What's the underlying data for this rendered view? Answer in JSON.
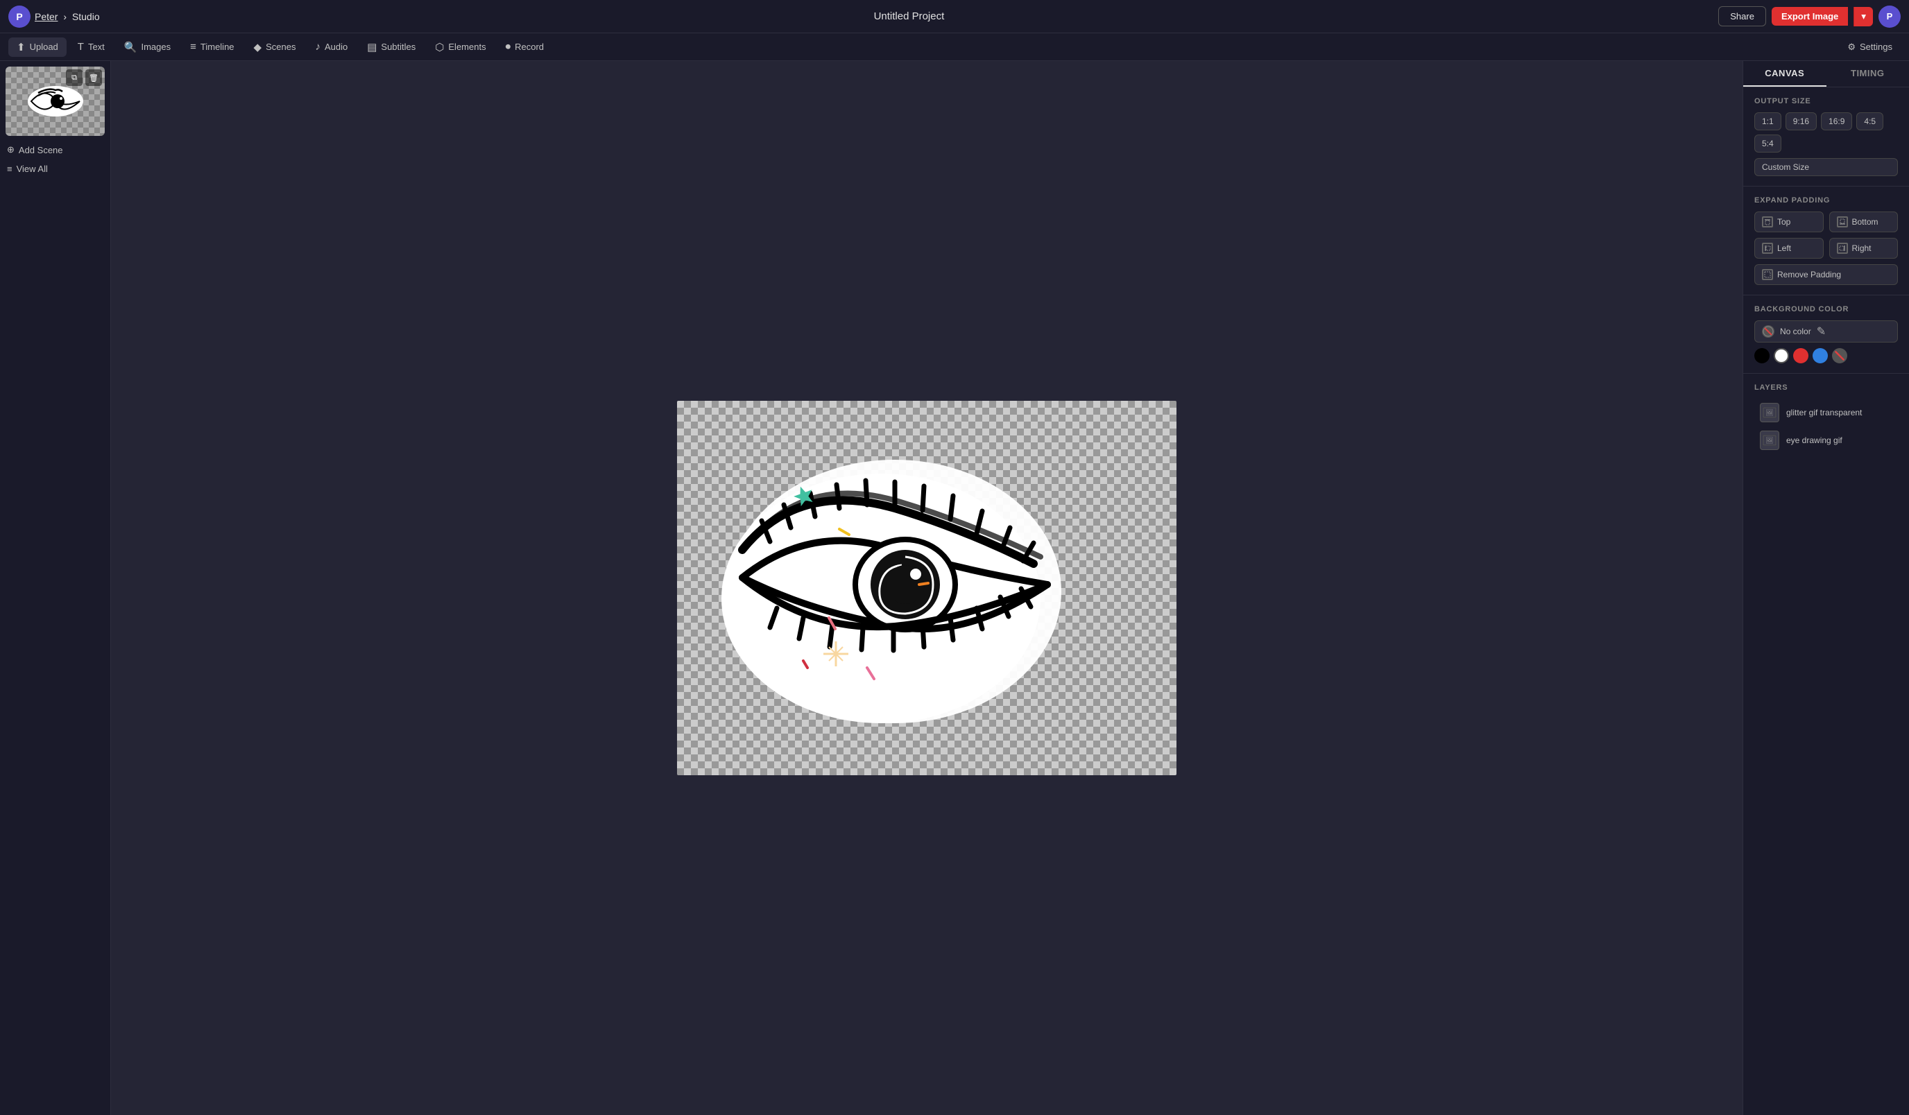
{
  "topbar": {
    "logo_initials": "P",
    "user_name": "Peter",
    "studio_label": "Studio",
    "breadcrumb_separator": "›",
    "project_title": "Untitled Project",
    "share_label": "Share",
    "export_label": "Export Image",
    "export_arrow": "▾",
    "user_avatar_initials": "P"
  },
  "toolbar": {
    "upload_label": "Upload",
    "text_label": "Text",
    "images_label": "Images",
    "timeline_label": "Timeline",
    "scenes_label": "Scenes",
    "audio_label": "Audio",
    "subtitles_label": "Subtitles",
    "elements_label": "Elements",
    "record_label": "Record",
    "settings_label": "Settings",
    "icons": {
      "upload": "⬆",
      "text": "T",
      "images": "🔍",
      "timeline": "≡",
      "scenes": "◆",
      "audio": "♪",
      "subtitles": "▤",
      "elements": "⬡",
      "record": "⏺",
      "settings": "⚙"
    }
  },
  "sidebar": {
    "add_scene_label": "Add Scene",
    "view_all_label": "View All",
    "add_icon": "+",
    "list_icon": "≡"
  },
  "right_panel": {
    "tabs": [
      {
        "id": "canvas",
        "label": "CANVAS",
        "active": true
      },
      {
        "id": "timing",
        "label": "TIMING",
        "active": false
      }
    ],
    "output_size": {
      "title": "OUTPUT SIZE",
      "buttons": [
        "1:1",
        "9:16",
        "16:9",
        "4:5",
        "5:4"
      ],
      "custom_label": "Custom Size"
    },
    "expand_padding": {
      "title": "EXPAND PADDING",
      "top_label": "Top",
      "bottom_label": "Bottom",
      "left_label": "Left",
      "right_label": "Right",
      "remove_label": "Remove Padding"
    },
    "background_color": {
      "title": "BACKGROUND COLOR",
      "no_color_label": "No color",
      "eyedropper_icon": "✎",
      "swatches": [
        "#000000",
        "#ffffff",
        "#e03030",
        "#3080e0",
        "#e0e0e0"
      ],
      "no_color_icon": "⊘"
    },
    "layers": {
      "title": "LAYERS",
      "items": [
        {
          "id": "layer1",
          "name": "glitter gif transparent",
          "icon": "🖼"
        },
        {
          "id": "layer2",
          "name": "eye drawing gif",
          "icon": "🖼"
        }
      ]
    }
  }
}
